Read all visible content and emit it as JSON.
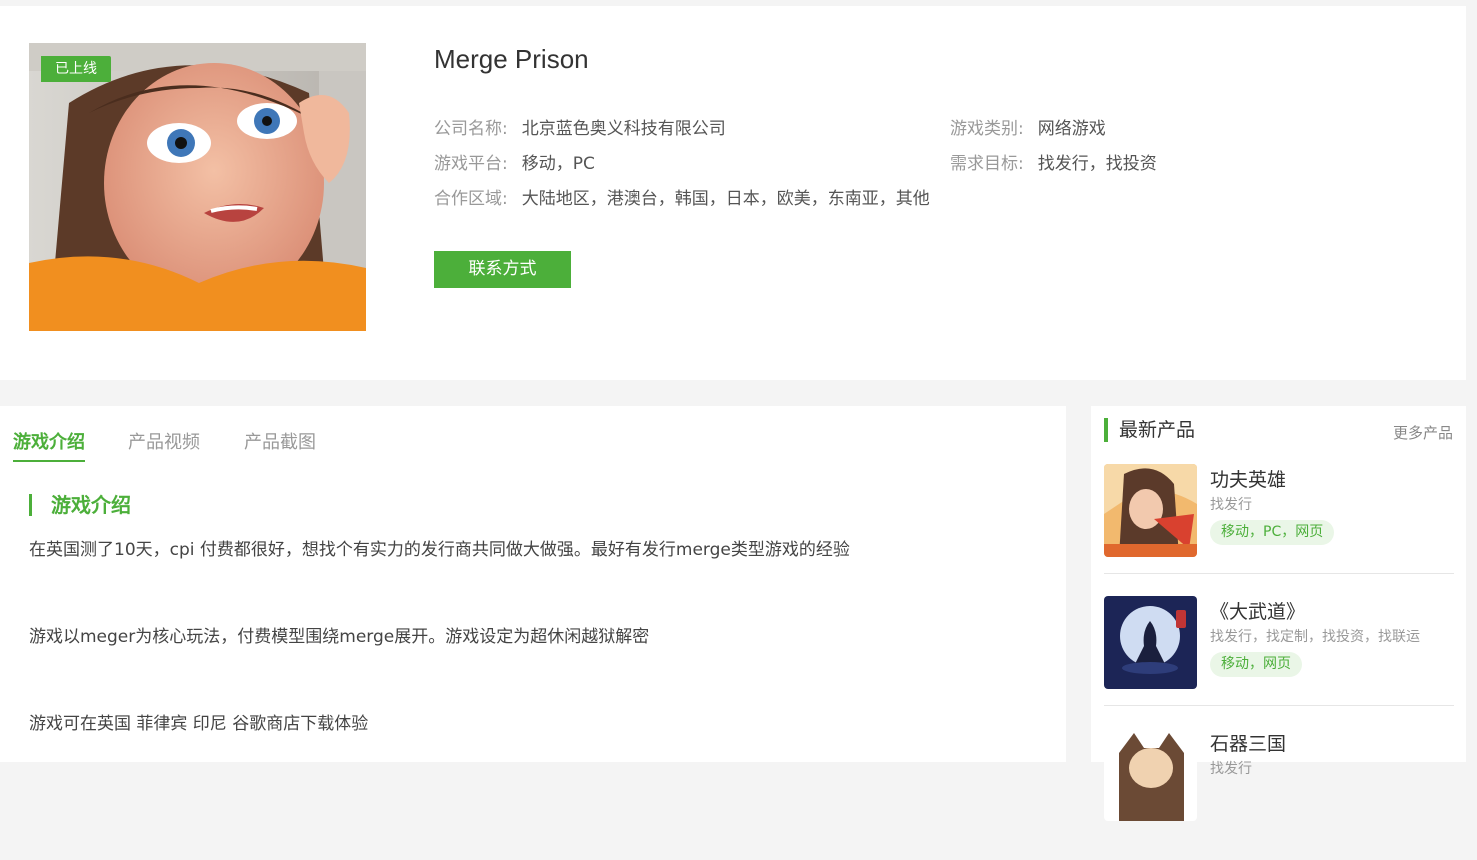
{
  "game": {
    "status_badge": "已上线",
    "title": "Merge Prison",
    "info": {
      "company_label": "公司名称:",
      "company": "北京蓝色奥义科技有限公司",
      "category_label": "游戏类别:",
      "category": "网络游戏",
      "platform_label": "游戏平台:",
      "platform": "移动，PC",
      "goal_label": "需求目标:",
      "goal": "找发行，找投资",
      "region_label": "合作区域:",
      "region": "大陆地区，港澳台，韩国，日本，欧美，东南亚，其他"
    },
    "contact_button": "联系方式"
  },
  "tabs": [
    "游戏介绍",
    "产品视频",
    "产品截图"
  ],
  "intro": {
    "heading": "游戏介绍",
    "paragraphs": [
      "在英国测了10天，cpi 付费都很好，想找个有实力的发行商共同做大做强。最好有发行merge类型游戏的经验",
      "游戏以meger为核心玩法，付费模型围绕merge展开。游戏设定为超休闲越狱解密",
      "游戏可在英国 菲律宾 印尼 谷歌商店下载体验"
    ]
  },
  "sidebar": {
    "title": "最新产品",
    "more": "更多产品",
    "products": [
      {
        "name": "功夫英雄",
        "need": "找发行",
        "platforms": "移动，PC，网页"
      },
      {
        "name": "《大武道》",
        "need": "找发行，找定制，找投资，找联运",
        "platforms": "移动，网页"
      },
      {
        "name": "石器三国",
        "need": "找发行",
        "platforms": ""
      }
    ]
  },
  "colors": {
    "accent": "#4caf3a",
    "accent_bg": "#eaf6e7",
    "page_bg": "#f4f4f4"
  }
}
